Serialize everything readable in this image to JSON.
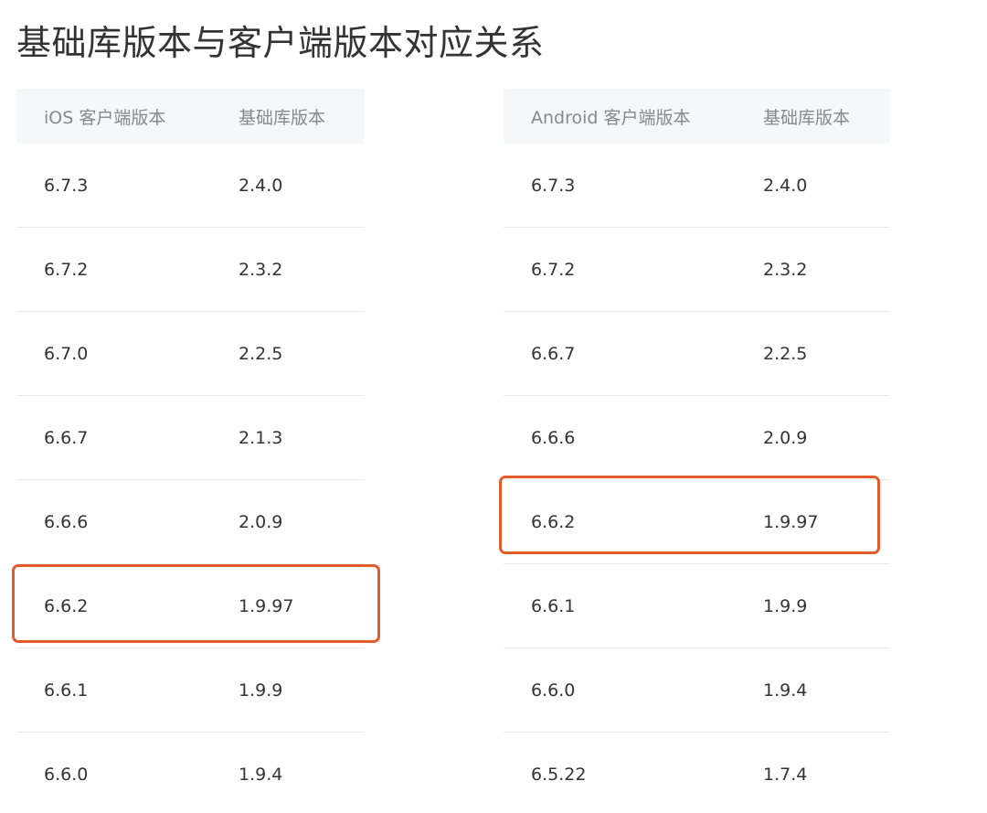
{
  "title": "基础库版本与客户端版本对应关系",
  "ios_table": {
    "headers": [
      "iOS 客户端版本",
      "基础库版本"
    ],
    "rows": [
      [
        "6.7.3",
        "2.4.0"
      ],
      [
        "6.7.2",
        "2.3.2"
      ],
      [
        "6.7.0",
        "2.2.5"
      ],
      [
        "6.6.7",
        "2.1.3"
      ],
      [
        "6.6.6",
        "2.0.9"
      ],
      [
        "6.6.2",
        "1.9.97"
      ],
      [
        "6.6.1",
        "1.9.9"
      ],
      [
        "6.6.0",
        "1.9.4"
      ]
    ],
    "highlighted_row": 5
  },
  "android_table": {
    "headers": [
      "Android 客户端版本",
      "基础库版本"
    ],
    "rows": [
      [
        "6.7.3",
        "2.4.0"
      ],
      [
        "6.7.2",
        "2.3.2"
      ],
      [
        "6.6.7",
        "2.2.5"
      ],
      [
        "6.6.6",
        "2.0.9"
      ],
      [
        "6.6.2",
        "1.9.97"
      ],
      [
        "6.6.1",
        "1.9.9"
      ],
      [
        "6.6.0",
        "1.9.4"
      ],
      [
        "6.5.22",
        "1.7.4"
      ]
    ],
    "highlighted_row": 4
  },
  "colors": {
    "highlight_border": "#e35a2b",
    "header_bg": "#f6f7f8",
    "header_text": "#888888",
    "body_text": "#333333",
    "row_divider": "#e8e8e8"
  }
}
